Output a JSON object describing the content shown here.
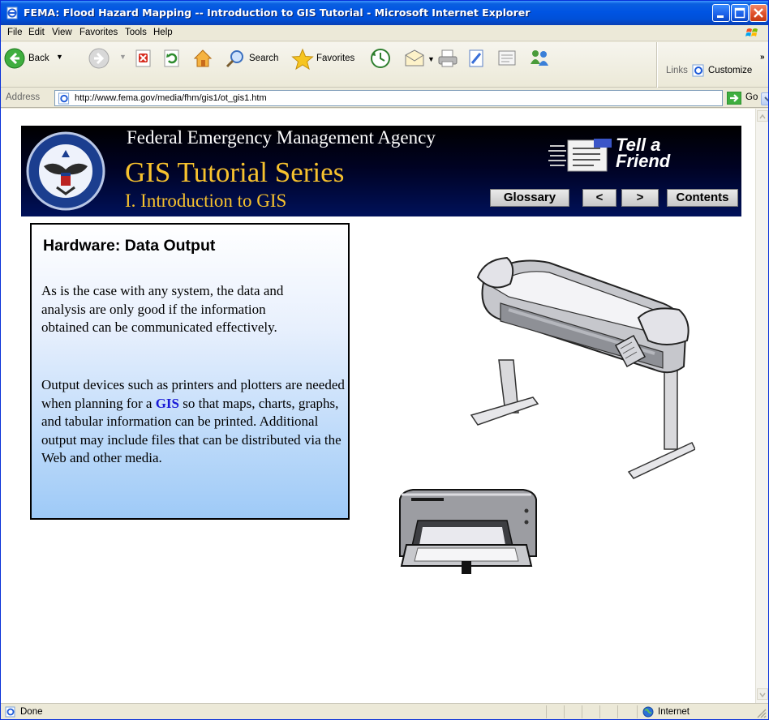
{
  "window": {
    "title": "FEMA: Flood Hazard Mapping -- Introduction to GIS Tutorial - Microsoft Internet Explorer"
  },
  "menu": {
    "items": [
      "File",
      "Edit",
      "View",
      "Favorites",
      "Tools",
      "Help"
    ]
  },
  "toolbar": {
    "back_label": "Back",
    "search_label": "Search",
    "favorites_label": "Favorites",
    "links_label": "Links",
    "customize_label": "Customize"
  },
  "address": {
    "label": "Address",
    "url": "http://www.fema.gov/media/fhm/gis1/ot_gis1.htm",
    "go_label": "Go"
  },
  "banner": {
    "agency": "Federal Emergency Management Agency",
    "series": "GIS Tutorial Series",
    "chapter": "I. Introduction to GIS",
    "tell_line1": "Tell a",
    "tell_line2": "Friend",
    "glossary_label": "Glossary",
    "prev_label": "<",
    "next_label": ">",
    "contents_label": "Contents"
  },
  "panel": {
    "title": "Hardware: Data Output",
    "para1": "As is the case with any system, the data and analysis are only good if the information obtained can be communicated effectively.",
    "para2_before": "Output devices such as printers and plotters are needed when planning for a ",
    "para2_link": "GIS",
    "para2_after": " so that maps, charts, graphs, and tabular information can be printed.  Additional output may include files that can be distributed via the Web and other media."
  },
  "status": {
    "text": "Done",
    "zone": "Internet"
  },
  "colors": {
    "title_gold": "#f7c22e",
    "link_blue": "#1919d6",
    "xp_blue": "#0054e3"
  }
}
